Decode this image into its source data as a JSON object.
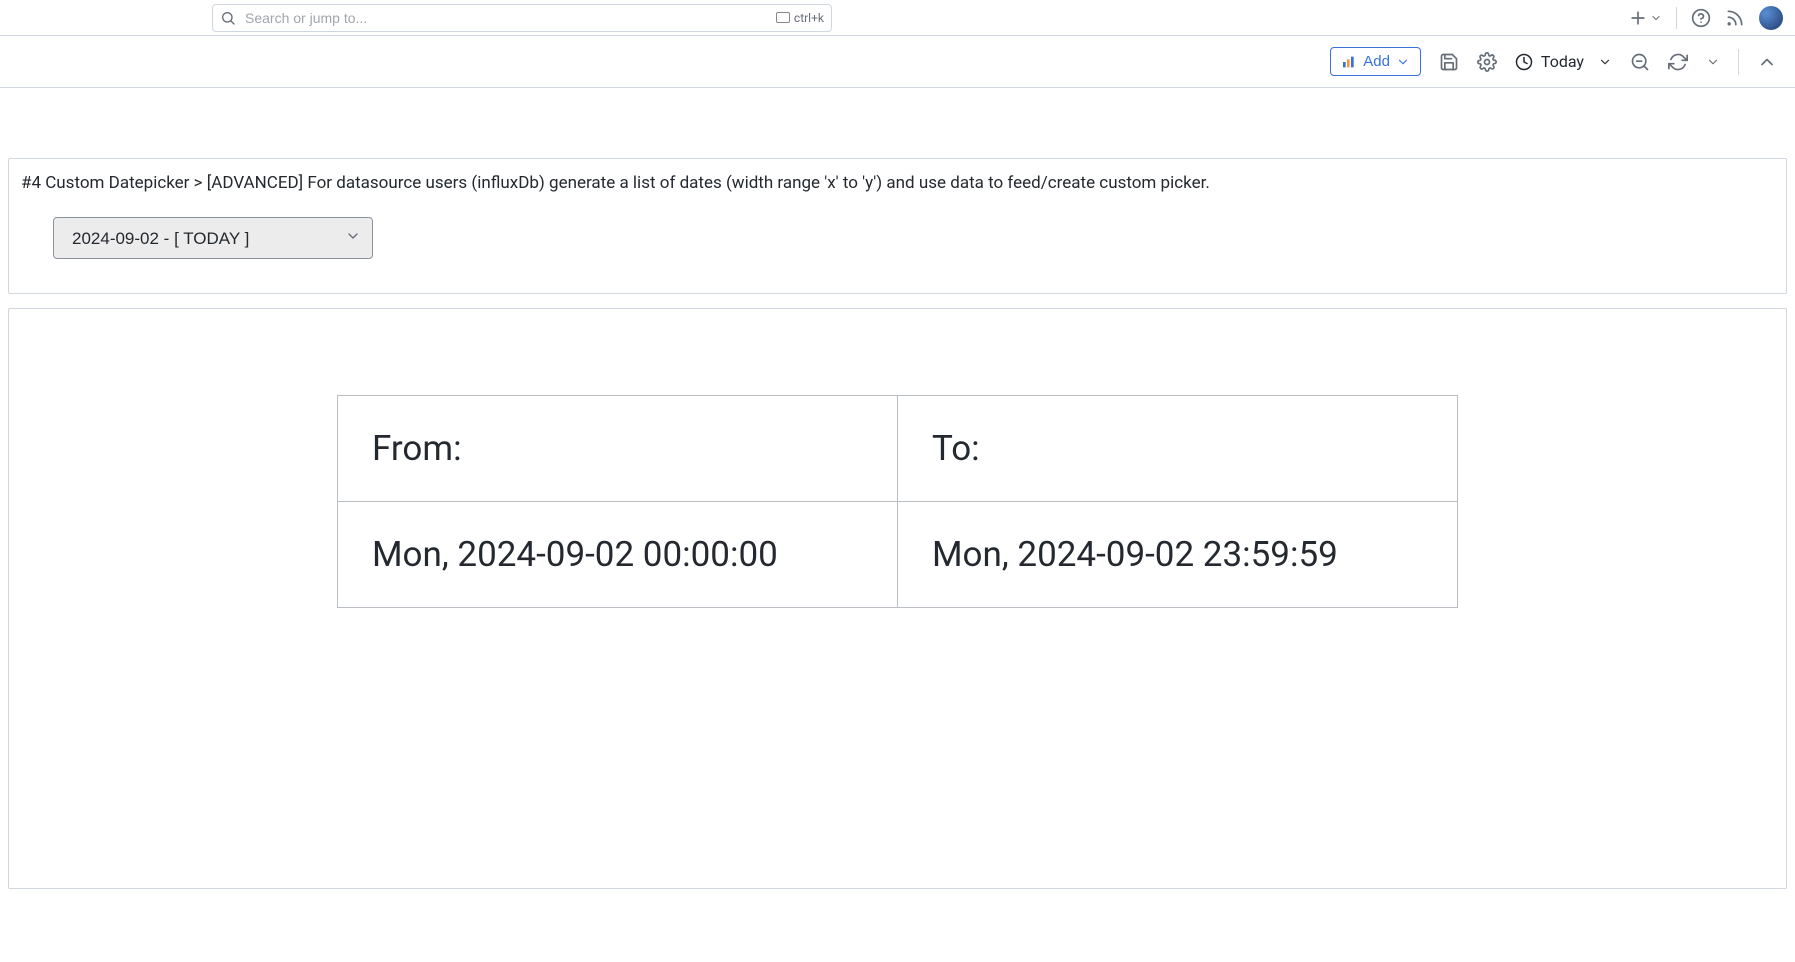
{
  "header": {
    "search_placeholder": "Search or jump to...",
    "kbd_hint": "ctrl+k"
  },
  "toolbar": {
    "add_label": "Add",
    "time_label": "Today"
  },
  "variables_panel": {
    "title": "#4 Custom Datepicker > [ADVANCED] For datasource users (influxDb) generate a list of dates (width range 'x' to 'y') and use data to feed/create custom picker.",
    "selected_date": "2024-09-02 - [ TODAY ]"
  },
  "table": {
    "headers": {
      "from": "From:",
      "to": "To:"
    },
    "row": {
      "from_value": "Mon, 2024-09-02 00:00:00",
      "to_value": "Mon, 2024-09-02 23:59:59"
    }
  }
}
